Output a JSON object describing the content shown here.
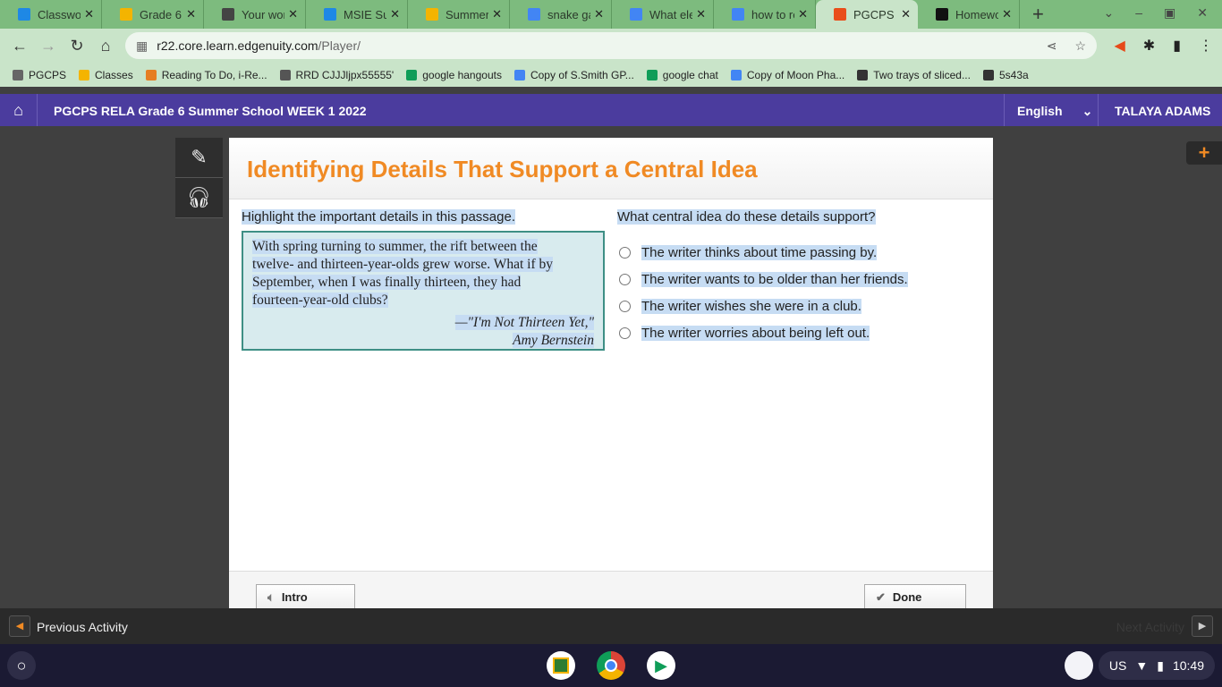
{
  "browser": {
    "tabs": [
      {
        "label": "Classwor",
        "icon": "classroom-icon",
        "color": "#1e88e5"
      },
      {
        "label": "Grade 6 l",
        "icon": "slides-icon",
        "color": "#f4b400"
      },
      {
        "label": "Your wor",
        "icon": "classroom-dark-icon",
        "color": "#444444"
      },
      {
        "label": "MSIE Sur",
        "icon": "classroom-icon",
        "color": "#1e88e5"
      },
      {
        "label": "Summer",
        "icon": "slides-icon",
        "color": "#f4b400"
      },
      {
        "label": "snake ga",
        "icon": "google-icon",
        "color": "#4285f4"
      },
      {
        "label": "What ele",
        "icon": "google-icon",
        "color": "#4285f4"
      },
      {
        "label": "how to re",
        "icon": "google-icon",
        "color": "#4285f4"
      },
      {
        "label": "PGCPS R",
        "icon": "edgenuity-icon",
        "color": "#e94e1b"
      },
      {
        "label": "Homewo",
        "icon": "brainly-icon",
        "color": "#111111"
      }
    ],
    "url_host": "r22.core.learn.edgenuity.com",
    "url_path": "/Player/",
    "bookmarks": [
      {
        "label": "PGCPS",
        "color": "#666666"
      },
      {
        "label": "Classes",
        "color": "#f4b400"
      },
      {
        "label": "Reading To Do, i-Re...",
        "color": "#e67e22"
      },
      {
        "label": "RRD CJJJljpx55555'",
        "color": "#555555"
      },
      {
        "label": "google hangouts",
        "color": "#0f9d58"
      },
      {
        "label": "Copy of S.Smith GP...",
        "color": "#4285f4"
      },
      {
        "label": "google chat",
        "color": "#0f9d58"
      },
      {
        "label": "Copy of Moon Pha...",
        "color": "#4285f4"
      },
      {
        "label": "Two trays of sliced...",
        "color": "#333333"
      },
      {
        "label": "5s43a",
        "color": "#333333"
      }
    ]
  },
  "app": {
    "course": "PGCPS RELA Grade 6 Summer School WEEK 1 2022",
    "language": "English",
    "user": "TALAYA ADAMS"
  },
  "activity": {
    "title": "Identifying Details That Support a Central Idea",
    "instruction": "Highlight the important details in this passage.",
    "passage_lines": [
      "With spring turning to summer, the rift between the",
      "twelve- and thirteen-year-olds grew worse. What if by",
      "September, when I was finally thirteen, they had",
      "fourteen-year-old clubs?"
    ],
    "citation_1": "—\"I'm Not Thirteen Yet,\"",
    "citation_2": "Amy Bernstein",
    "question": "What central idea do these details support?",
    "options": [
      "The writer thinks about time passing by.",
      "The writer wants to be older than her friends.",
      "The writer wishes she were in a club.",
      "The writer worries about being left out."
    ],
    "intro_label": "Intro",
    "done_label": "Done"
  },
  "nav": {
    "previous": "Previous Activity",
    "next": "Next Activity"
  },
  "shelf": {
    "locale": "US",
    "time": "10:49"
  }
}
